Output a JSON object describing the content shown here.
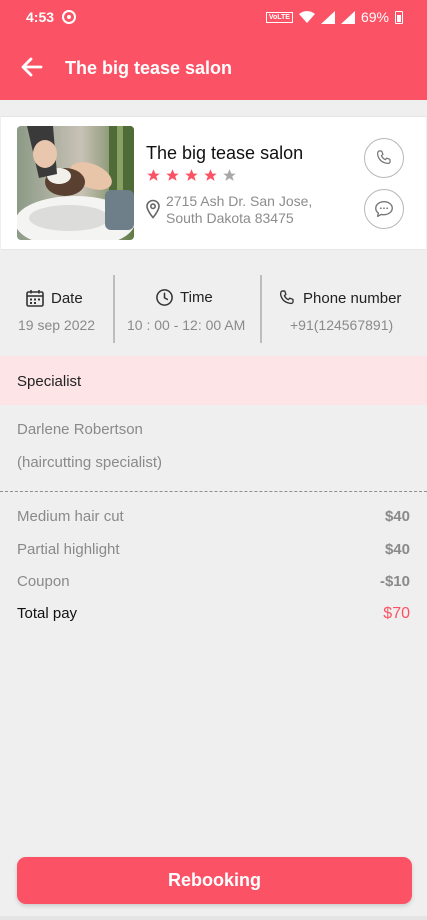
{
  "status_bar": {
    "time": "4:53",
    "volte": "VoLTE",
    "battery": "69%"
  },
  "header": {
    "title": "The big tease salon"
  },
  "salon": {
    "name": "The big tease salon",
    "rating": 4,
    "rating_max": 5,
    "address_line1": "2715 Ash Dr. San Jose,",
    "address_line2": "South Dakota 83475"
  },
  "info": {
    "date_label": "Date",
    "date_value": "19 sep 2022",
    "time_label": "Time",
    "time_value": "10 : 00 - 12: 00 AM",
    "phone_label": "Phone number",
    "phone_value": "+91(124567891)"
  },
  "specialist": {
    "title": "Specialist",
    "name": "Darlene Robertson",
    "role": "(haircutting specialist)"
  },
  "pricing": [
    {
      "label": "Medium hair cut",
      "value": "$40"
    },
    {
      "label": "Partial highlight",
      "value": "$40"
    },
    {
      "label": "Coupon",
      "value": "-$10"
    }
  ],
  "total": {
    "label": "Total pay",
    "value": "$70"
  },
  "actions": {
    "rebook_label": "Rebooking"
  },
  "colors": {
    "accent": "#fb5365",
    "accent_light": "#fde5e7",
    "star_on": "#fb5365",
    "star_off": "#a8a8a8"
  },
  "icons": {
    "back": "arrow-left-icon",
    "location": "location-pin-icon",
    "call": "phone-icon",
    "chat": "chat-bubble-icon",
    "date": "calendar-icon",
    "time": "clock-icon",
    "phone": "phone-icon"
  }
}
